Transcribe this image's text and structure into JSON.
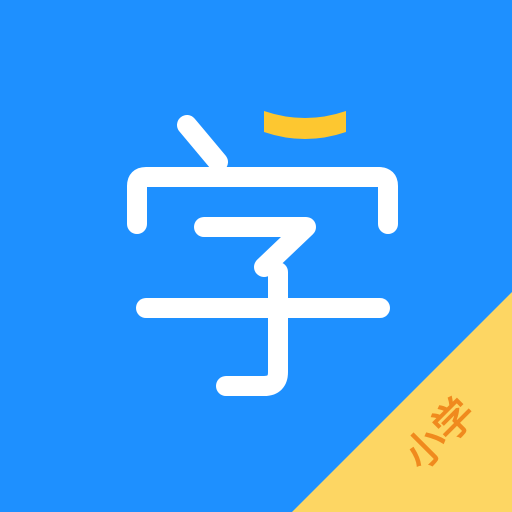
{
  "app_icon": {
    "glyph_icon": "xue-character-icon",
    "corner_label": "小学",
    "colors": {
      "background": "#1E90FF",
      "glyph": "#FFFFFF",
      "accent": "#FDC730",
      "ribbon": "#FDD663",
      "ribbon_text": "#F08A1E"
    }
  }
}
